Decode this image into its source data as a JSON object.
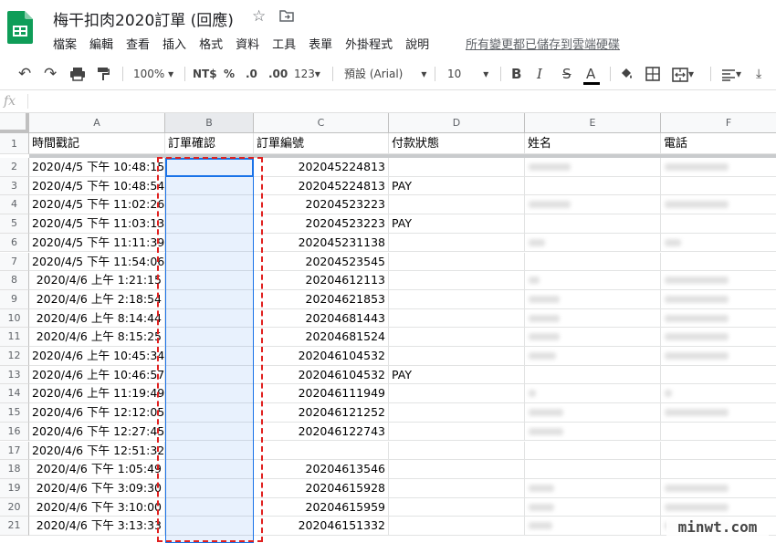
{
  "doc": {
    "title": "梅干扣肉2020訂單 (回應)",
    "saved_status": "所有變更都已儲存到雲端硬碟"
  },
  "menu": [
    "檔案",
    "編輯",
    "查看",
    "插入",
    "格式",
    "資料",
    "工具",
    "表單",
    "外掛程式",
    "說明"
  ],
  "toolbar": {
    "zoom": "100%",
    "currency": "NT$",
    "percent": "%",
    "dec_less": ".0",
    "dec_more": ".00",
    "more_formats": "123",
    "font": "預設 (Arial)",
    "font_size": "10",
    "bold": "B",
    "italic": "I",
    "strike": "S",
    "text_color": "A"
  },
  "formula_bar": {
    "label": "fx",
    "value": ""
  },
  "columns": [
    "A",
    "B",
    "C",
    "D",
    "E",
    "F"
  ],
  "header_row": [
    "時間戳記",
    "訂單確認",
    "訂單編號",
    "付款狀態",
    "姓名",
    "電話"
  ],
  "row_numbers": [
    "1",
    "2",
    "3",
    "4",
    "5",
    "6",
    "7",
    "8",
    "9",
    "10",
    "11",
    "12",
    "13",
    "14",
    "15",
    "16",
    "17",
    "18",
    "19",
    "20",
    "21"
  ],
  "rows": [
    {
      "ts": "2020/4/5 下午 10:48:15",
      "order": "202045224813",
      "pay": ""
    },
    {
      "ts": "2020/4/5 下午 10:48:54",
      "order": "202045224813",
      "pay": "PAY"
    },
    {
      "ts": "2020/4/5 下午 11:02:26",
      "order": "20204523223",
      "pay": ""
    },
    {
      "ts": "2020/4/5 下午 11:03:13",
      "order": "20204523223",
      "pay": "PAY"
    },
    {
      "ts": "2020/4/5 下午 11:11:39",
      "order": "202045231138",
      "pay": ""
    },
    {
      "ts": "2020/4/5 下午 11:54:06",
      "order": "20204523545",
      "pay": ""
    },
    {
      "ts": "2020/4/6 上午 1:21:15",
      "order": "20204612113",
      "pay": ""
    },
    {
      "ts": "2020/4/6 上午 2:18:54",
      "order": "20204621853",
      "pay": ""
    },
    {
      "ts": "2020/4/6 上午 8:14:44",
      "order": "20204681443",
      "pay": ""
    },
    {
      "ts": "2020/4/6 上午 8:15:25",
      "order": "20204681524",
      "pay": ""
    },
    {
      "ts": "2020/4/6 上午 10:45:34",
      "order": "202046104532",
      "pay": ""
    },
    {
      "ts": "2020/4/6 上午 10:46:57",
      "order": "202046104532",
      "pay": "PAY"
    },
    {
      "ts": "2020/4/6 上午 11:19:49",
      "order": "202046111949",
      "pay": ""
    },
    {
      "ts": "2020/4/6 下午 12:12:05",
      "order": "202046121252",
      "pay": ""
    },
    {
      "ts": "2020/4/6 下午 12:27:45",
      "order": "202046122743",
      "pay": ""
    },
    {
      "ts": "2020/4/6 下午 12:51:32",
      "order": "",
      "pay": ""
    },
    {
      "ts": "2020/4/6 下午 1:05:49",
      "order": "20204613546",
      "pay": ""
    },
    {
      "ts": "2020/4/6 下午 3:09:30",
      "order": "20204615928",
      "pay": ""
    },
    {
      "ts": "2020/4/6 下午 3:10:00",
      "order": "20204615959",
      "pay": ""
    },
    {
      "ts": "2020/4/6 下午 3:13:33",
      "order": "202046151332",
      "pay": ""
    }
  ],
  "watermark": "minwt.com",
  "colors": {
    "sheets_green": "#0f9d58",
    "selection_blue": "#1a73e8",
    "annotation_red": "#e0201f"
  }
}
